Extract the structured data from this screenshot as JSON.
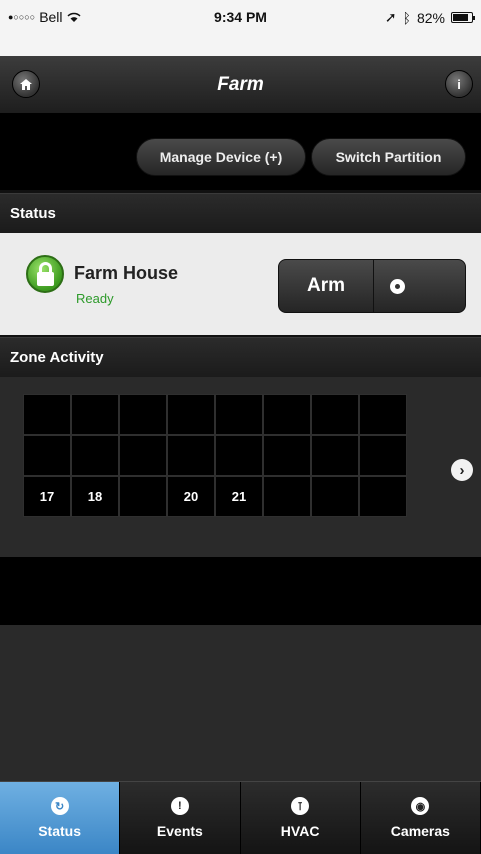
{
  "statusbar": {
    "signal_dots": "●○○○○",
    "carrier": "Bell",
    "wifi": "wifi-icon",
    "time": "9:34 PM",
    "battery": "82%",
    "battery_level": 0.82
  },
  "nav": {
    "title": "Farm",
    "home_icon": "home-icon",
    "info_icon": "info-icon",
    "info_glyph": "i"
  },
  "actions": {
    "manage_device": "Manage Device (+)",
    "switch_partition": "Switch Partition"
  },
  "status_section": {
    "header": "Status",
    "partition_name": "Farm House",
    "partition_state": "Ready",
    "arm_label": "Arm"
  },
  "zone_section": {
    "header": "Zone Activity",
    "rows": [
      [
        "",
        "",
        "",
        "",
        "",
        "",
        "",
        ""
      ],
      [
        "",
        "",
        "",
        "",
        "",
        "",
        "",
        ""
      ],
      [
        "17",
        "18",
        "",
        "20",
        "21",
        "",
        "",
        ""
      ]
    ],
    "next_glyph": "›"
  },
  "tabs": [
    {
      "label": "Status",
      "icon": "refresh-icon",
      "glyph": "↻",
      "active": true
    },
    {
      "label": "Events",
      "icon": "warning-icon",
      "glyph": "!",
      "active": false
    },
    {
      "label": "HVAC",
      "icon": "thermometer-icon",
      "glyph": "⊺",
      "active": false
    },
    {
      "label": "Cameras",
      "icon": "eye-icon",
      "glyph": "◉",
      "active": false
    }
  ],
  "colors": {
    "ready_green": "#2d9a2a",
    "active_tab": "#4f97d3"
  }
}
